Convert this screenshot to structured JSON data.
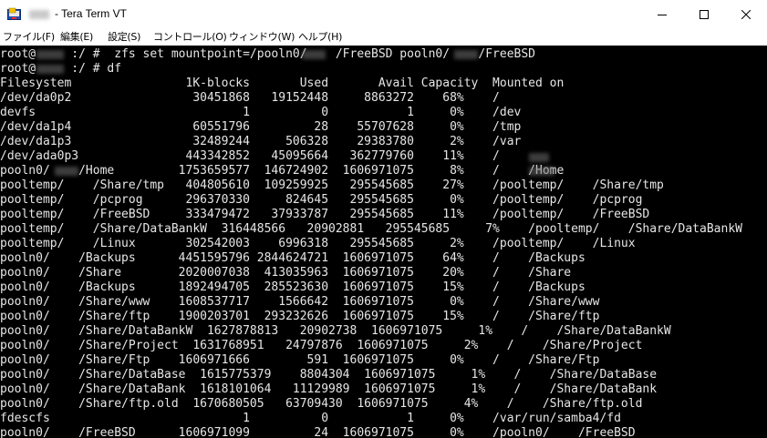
{
  "window": {
    "title": "- Tera Term VT",
    "icon": "teraterm-app-icon"
  },
  "menu": [
    {
      "label": "ファイル(F)"
    },
    {
      "label": "編集(E)"
    },
    {
      "label": "設定(S)"
    },
    {
      "label": "コントロール(O)"
    },
    {
      "label": "ウィンドウ(W)"
    },
    {
      "label": "ヘルプ(H)"
    }
  ],
  "terminal": {
    "colors": {
      "background": "#000000",
      "foreground": "#e6e6e6"
    },
    "lines": [
      "root@     :/ #  zfs set mountpoint=/pooln0/    /FreeBSD pooln0/    /FreeBSD",
      "root@     :/ # df",
      "Filesystem                1K-blocks       Used       Avail Capacity  Mounted on",
      "/dev/da0p2                 30451868   19152448     8863272    68%    /",
      "devfs                             1          0           1     0%    /dev",
      "/dev/da1p4                 60551796         28    55707628     0%    /tmp",
      "/dev/da1p3                 32489244     506328    29383780     2%    /var",
      "/dev/ada0p3               443342852   45095664   362779760    11%    /",
      "pooln0/    /Home         1753659577  146724902  1606971075     8%    /    /Home",
      "pooltemp/    /Share/tmp   404805610  109259925   295545685    27%    /pooltemp/    /Share/tmp",
      "pooltemp/    /pcprog      296370330     824645   295545685     0%    /pooltemp/    /pcprog",
      "pooltemp/    /FreeBSD     333479472   37933787   295545685    11%    /pooltemp/    /FreeBSD",
      "pooltemp/    /Share/DataBankW  316448566   20902881   295545685     7%    /pooltemp/    /Share/DataBankW",
      "pooltemp/    /Linux       302542003    6996318   295545685     2%    /pooltemp/    /Linux",
      "pooln0/    /Backups      4451595796 2844624721  1606971075    64%    /    /Backups",
      "pooln0/    /Share        2020007038  413035963  1606971075    20%    /    /Share",
      "pooln0/    /Backups      1892494705  285523630  1606971075    15%    /    /Backups",
      "pooln0/    /Share/www    1608537717    1566642  1606971075     0%    /    /Share/www",
      "pooln0/    /Share/ftp    1900203701  293232626  1606971075    15%    /    /Share/ftp",
      "pooln0/    /Share/DataBankW  1627878813   20902738  1606971075     1%    /    /Share/DataBankW",
      "pooln0/    /Share/Project  1631768951   24797876  1606971075     2%    /    /Share/Project",
      "pooln0/    /Share/Ftp    1606971666        591  1606971075     0%    /    /Share/Ftp",
      "pooln0/    /Share/DataBase  1615775379    8804304  1606971075     1%    /    /Share/DataBase",
      "pooln0/    /Share/DataBank  1618101064   11129989  1606971075     1%    /    /Share/DataBank",
      "pooln0/    /Share/ftp.old  1670680505   63709430  1606971075     4%    /    /Share/ftp.old",
      "fdescfs                           1          0           1     0%    /var/run/samba4/fd",
      "pooln0/    /FreeBSD      1606971099         24  1606971075     0%    /pooln0/    /FreeBSD"
    ]
  }
}
